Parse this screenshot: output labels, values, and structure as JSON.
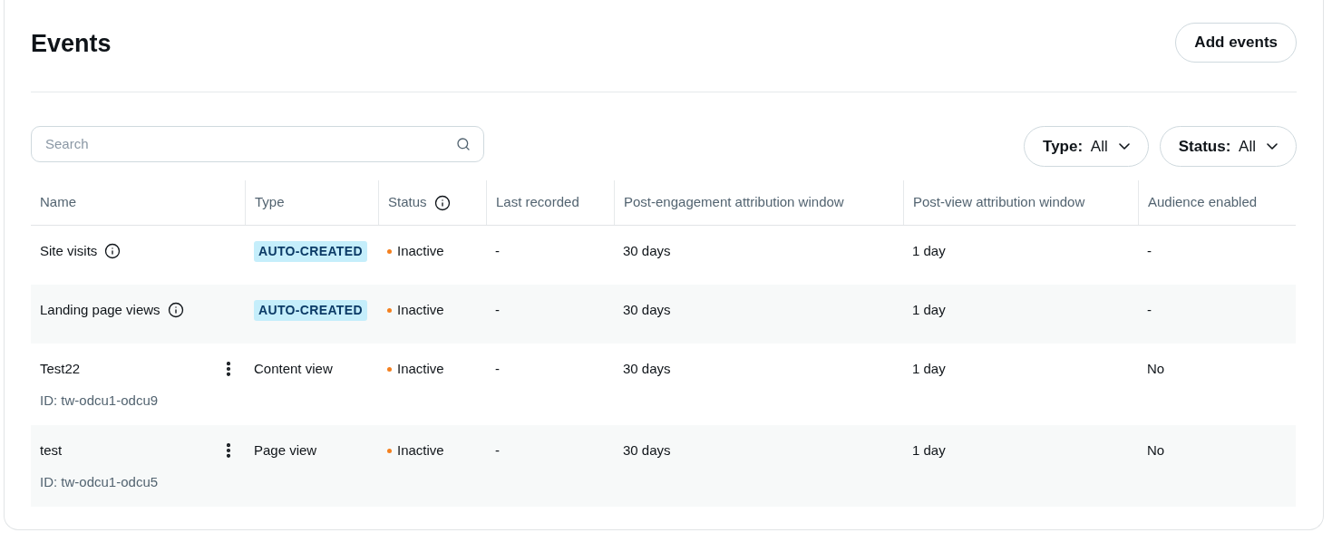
{
  "title": "Events",
  "add_button": "Add events",
  "search": {
    "placeholder": "Search"
  },
  "filters": [
    {
      "label": "Type:",
      "value": "All"
    },
    {
      "label": "Status:",
      "value": "All"
    }
  ],
  "columns": [
    {
      "label": "Name",
      "info": false
    },
    {
      "label": "Type",
      "info": false
    },
    {
      "label": "Status",
      "info": true
    },
    {
      "label": "Last recorded",
      "info": false
    },
    {
      "label": "Post-engagement attribution window",
      "info": false
    },
    {
      "label": "Post-view attribution window",
      "info": false
    },
    {
      "label": "Audience enabled",
      "info": false
    }
  ],
  "rows": [
    {
      "name": "Site visits",
      "info": true,
      "menu": false,
      "type": {
        "kind": "badge",
        "label": "AUTO-CREATED"
      },
      "status": "Inactive",
      "color": "#f4801f",
      "last": "-",
      "post_engagement": "30 days",
      "post_view": "1 day",
      "audience": "-"
    },
    {
      "name": "Landing page views",
      "info": true,
      "menu": false,
      "type": {
        "kind": "badge",
        "label": "AUTO-CREATED"
      },
      "status": "Inactive",
      "color": "#f4801f",
      "last": "-",
      "post_engagement": "30 days",
      "post_view": "1 day",
      "audience": "-"
    },
    {
      "name": "Test22",
      "id": "ID: tw-odcu1-odcu9",
      "info": false,
      "menu": true,
      "type": {
        "kind": "text",
        "label": "Content view"
      },
      "status": "Inactive",
      "color": "#f4801f",
      "last": "-",
      "post_engagement": "30 days",
      "post_view": "1 day",
      "audience": "No"
    },
    {
      "name": "test",
      "id": "ID: tw-odcu1-odcu5",
      "info": false,
      "menu": true,
      "type": {
        "kind": "text",
        "label": "Page view"
      },
      "status": "Inactive",
      "color": "#f4801f",
      "last": "-",
      "post_engagement": "30 days",
      "post_view": "1 day",
      "audience": "No"
    }
  ]
}
